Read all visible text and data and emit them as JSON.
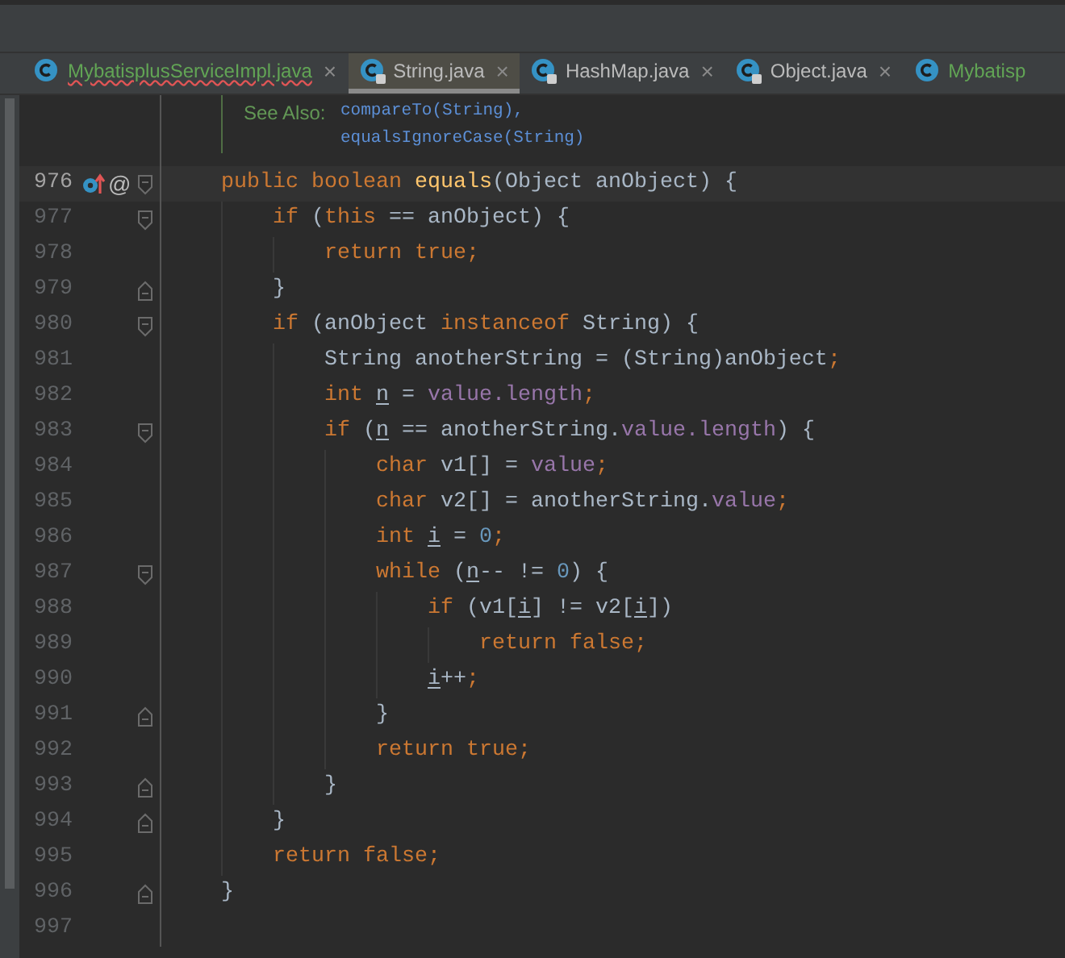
{
  "tabs": [
    {
      "label": "MybatisplusServiceImpl.java",
      "selected": false,
      "locked": false,
      "added": true,
      "has_errors": true,
      "close": "×"
    },
    {
      "label": "String.java",
      "selected": true,
      "locked": true,
      "added": false,
      "has_errors": false,
      "close": "×"
    },
    {
      "label": "HashMap.java",
      "selected": false,
      "locked": true,
      "added": false,
      "has_errors": false,
      "close": "×"
    },
    {
      "label": "Object.java",
      "selected": false,
      "locked": true,
      "added": false,
      "has_errors": false,
      "close": "×"
    },
    {
      "label": "Mybatisp",
      "selected": false,
      "locked": false,
      "added": true,
      "has_errors": false
    }
  ],
  "doc": {
    "label": "See Also:",
    "links": [
      "compareTo(String),",
      "equalsIgnoreCase(String)"
    ]
  },
  "lines": [
    {
      "number": "976",
      "current": true,
      "fold_start": true,
      "fold_end": false,
      "marks": [
        {
          "kind": "override"
        },
        {
          "kind": "annotation",
          "text": "@"
        }
      ],
      "tokens": [
        {
          "kind": "kw",
          "text": "public boolean "
        },
        {
          "kind": "fn",
          "text": "equals"
        },
        {
          "kind": "id",
          "text": "(Object anObject) {"
        }
      ],
      "children": [
        {
          "number": "977",
          "current": false,
          "fold_start": true,
          "fold_end": false,
          "tokens": [
            {
              "kind": "kw",
              "text": "if"
            },
            {
              "kind": "id",
              "text": " ("
            },
            {
              "kind": "kw",
              "text": "this"
            },
            {
              "kind": "id",
              "text": " == anObject) {"
            }
          ],
          "children": [
            {
              "number": "978",
              "current": false,
              "fold_start": false,
              "fold_end": false,
              "tokens": [
                {
                  "kind": "kw",
                  "text": "return true;"
                }
              ]
            }
          ]
        },
        {
          "number": "979",
          "current": false,
          "fold_start": false,
          "fold_end": true,
          "tokens": [
            {
              "kind": "id",
              "text": "}"
            }
          ]
        },
        {
          "number": "980",
          "current": false,
          "fold_start": true,
          "fold_end": false,
          "tokens": [
            {
              "kind": "kw",
              "text": "if"
            },
            {
              "kind": "id",
              "text": " (anObject "
            },
            {
              "kind": "kw",
              "text": "instanceof"
            },
            {
              "kind": "id",
              "text": " String) {"
            }
          ],
          "children": [
            {
              "number": "981",
              "current": false,
              "fold_start": false,
              "fold_end": false,
              "tokens": [
                {
                  "kind": "id",
                  "text": "String anotherString = (String)anObject"
                },
                {
                  "kind": "kw",
                  "text": ";"
                }
              ]
            },
            {
              "number": "982",
              "current": false,
              "fold_start": false,
              "fold_end": false,
              "tokens": [
                {
                  "kind": "kw",
                  "text": "int "
                },
                {
                  "kind": "var",
                  "text": "n"
                },
                {
                  "kind": "id",
                  "text": " = "
                },
                {
                  "kind": "field",
                  "text": "value.length"
                },
                {
                  "kind": "kw",
                  "text": ";"
                }
              ]
            },
            {
              "number": "983",
              "current": false,
              "fold_start": true,
              "fold_end": false,
              "tokens": [
                {
                  "kind": "kw",
                  "text": "if"
                },
                {
                  "kind": "id",
                  "text": " ("
                },
                {
                  "kind": "var",
                  "text": "n"
                },
                {
                  "kind": "id",
                  "text": " == anotherString."
                },
                {
                  "kind": "field",
                  "text": "value.length"
                },
                {
                  "kind": "id",
                  "text": ") {"
                }
              ],
              "children": [
                {
                  "number": "984",
                  "current": false,
                  "fold_start": false,
                  "fold_end": false,
                  "tokens": [
                    {
                      "kind": "kw",
                      "text": "char "
                    },
                    {
                      "kind": "id",
                      "text": "v1[] = "
                    },
                    {
                      "kind": "field",
                      "text": "value"
                    },
                    {
                      "kind": "kw",
                      "text": ";"
                    }
                  ]
                },
                {
                  "number": "985",
                  "current": false,
                  "fold_start": false,
                  "fold_end": false,
                  "tokens": [
                    {
                      "kind": "kw",
                      "text": "char "
                    },
                    {
                      "kind": "id",
                      "text": "v2[] = anotherString."
                    },
                    {
                      "kind": "field",
                      "text": "value"
                    },
                    {
                      "kind": "kw",
                      "text": ";"
                    }
                  ]
                },
                {
                  "number": "986",
                  "current": false,
                  "fold_start": false,
                  "fold_end": false,
                  "tokens": [
                    {
                      "kind": "kw",
                      "text": "int "
                    },
                    {
                      "kind": "var",
                      "text": "i"
                    },
                    {
                      "kind": "id",
                      "text": " = "
                    },
                    {
                      "kind": "num",
                      "text": "0"
                    },
                    {
                      "kind": "kw",
                      "text": ";"
                    }
                  ]
                },
                {
                  "number": "987",
                  "current": false,
                  "fold_start": true,
                  "fold_end": false,
                  "tokens": [
                    {
                      "kind": "kw",
                      "text": "while"
                    },
                    {
                      "kind": "id",
                      "text": " ("
                    },
                    {
                      "kind": "var",
                      "text": "n"
                    },
                    {
                      "kind": "id",
                      "text": "-- != "
                    },
                    {
                      "kind": "num",
                      "text": "0"
                    },
                    {
                      "kind": "id",
                      "text": ") {"
                    }
                  ],
                  "children": [
                    {
                      "number": "988",
                      "current": false,
                      "fold_start": false,
                      "fold_end": false,
                      "tokens": [
                        {
                          "kind": "kw",
                          "text": "if"
                        },
                        {
                          "kind": "id",
                          "text": " (v1["
                        },
                        {
                          "kind": "var",
                          "text": "i"
                        },
                        {
                          "kind": "id",
                          "text": "] != v2["
                        },
                        {
                          "kind": "var",
                          "text": "i"
                        },
                        {
                          "kind": "id",
                          "text": "])"
                        }
                      ],
                      "children": [
                        {
                          "number": "989",
                          "current": false,
                          "fold_start": false,
                          "fold_end": false,
                          "tokens": [
                            {
                              "kind": "kw",
                              "text": "return false;"
                            }
                          ]
                        }
                      ]
                    },
                    {
                      "number": "990",
                      "current": false,
                      "fold_start": false,
                      "fold_end": false,
                      "tokens": [
                        {
                          "kind": "var",
                          "text": "i"
                        },
                        {
                          "kind": "id",
                          "text": "++"
                        },
                        {
                          "kind": "kw",
                          "text": ";"
                        }
                      ]
                    }
                  ]
                },
                {
                  "number": "991",
                  "current": false,
                  "fold_start": false,
                  "fold_end": true,
                  "tokens": [
                    {
                      "kind": "id",
                      "text": "}"
                    }
                  ]
                },
                {
                  "number": "992",
                  "current": false,
                  "fold_start": false,
                  "fold_end": false,
                  "tokens": [
                    {
                      "kind": "kw",
                      "text": "return true;"
                    }
                  ]
                }
              ]
            },
            {
              "number": "993",
              "current": false,
              "fold_start": false,
              "fold_end": true,
              "tokens": [
                {
                  "kind": "id",
                  "text": "}"
                }
              ]
            }
          ]
        },
        {
          "number": "994",
          "current": false,
          "fold_start": false,
          "fold_end": true,
          "tokens": [
            {
              "kind": "id",
              "text": "}"
            }
          ]
        },
        {
          "number": "995",
          "current": false,
          "fold_start": false,
          "fold_end": false,
          "tokens": [
            {
              "kind": "kw",
              "text": "return false;"
            }
          ]
        }
      ]
    },
    {
      "number": "996",
      "current": false,
      "fold_start": false,
      "fold_end": true,
      "tokens": [
        {
          "kind": "id",
          "text": "}"
        }
      ]
    },
    {
      "number": "997",
      "current": false,
      "fold_start": false,
      "fold_end": false
    }
  ]
}
